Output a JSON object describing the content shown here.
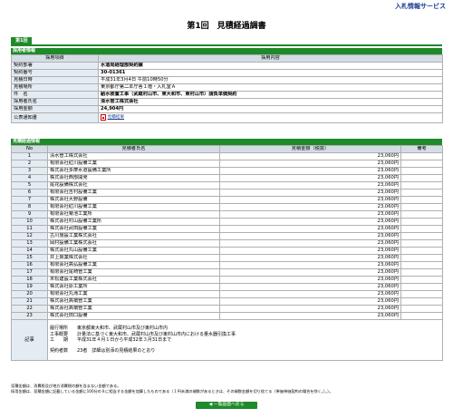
{
  "header": {
    "site_title": "入札情報サービス",
    "doc_title": "第1回　見積経過調書"
  },
  "tab": {
    "label": "第1回"
  },
  "adopted_section": {
    "title": "採用者情報",
    "col_item": "採用項目",
    "col_content": "採用内容",
    "rows": [
      {
        "label": "契約部署",
        "value": "水道局経理部契約課"
      },
      {
        "label": "契約番号",
        "value": "30-01361"
      },
      {
        "label": "見積日時",
        "value": "平成31年3月4日 午前10時50分"
      },
      {
        "label": "見積場所",
        "value": "東京都庁第二本庁舎１階・入札室Ａ"
      },
      {
        "label": "件　名",
        "value": "給水装置工事（武蔵村山市、東大和市、東村山市）請負単価契約"
      },
      {
        "label": "採用者氏名",
        "value": "清水管工株式会社"
      },
      {
        "label": "採用金額",
        "value": "24,904円"
      }
    ],
    "notice": {
      "label": "公表通知書",
      "link": "見積結果"
    }
  },
  "process_section": {
    "title": "見積経過情報",
    "col_no": "No",
    "col_name": "見積者氏名",
    "col_amount": "見積金額（税抜）",
    "col_remarks": "備考",
    "rows": [
      {
        "no": "1",
        "name": "清水管工株式会社",
        "amount": "23,060円",
        "remarks": ""
      },
      {
        "no": "2",
        "name": "有限会社紅川設備工業",
        "amount": "23,060円",
        "remarks": ""
      },
      {
        "no": "3",
        "name": "株式会社多摩水道設備工業所",
        "amount": "23,060円",
        "remarks": ""
      },
      {
        "no": "4",
        "name": "株式会社西部開発",
        "amount": "23,060円",
        "remarks": ""
      },
      {
        "no": "5",
        "name": "尾花設備株式会社",
        "amount": "23,060円",
        "remarks": ""
      },
      {
        "no": "6",
        "name": "有限会社吉村設備工業",
        "amount": "23,060円",
        "remarks": ""
      },
      {
        "no": "7",
        "name": "株式会社大野設備",
        "amount": "23,060円",
        "remarks": ""
      },
      {
        "no": "8",
        "name": "有限会社紅川設備工業",
        "amount": "23,060円",
        "remarks": ""
      },
      {
        "no": "9",
        "name": "有限会社菊池工業所",
        "amount": "23,060円",
        "remarks": ""
      },
      {
        "no": "10",
        "name": "株式会社村山設備工業所",
        "amount": "23,060円",
        "remarks": ""
      },
      {
        "no": "11",
        "name": "株式会社武田設備工業",
        "amount": "23,060円",
        "remarks": ""
      },
      {
        "no": "12",
        "name": "古川施設工業株式会社",
        "amount": "23,060円",
        "remarks": ""
      },
      {
        "no": "13",
        "name": "岡村設備工業株式会社",
        "amount": "23,060円",
        "remarks": ""
      },
      {
        "no": "14",
        "name": "株式会社丸山設備工業",
        "amount": "23,060円",
        "remarks": ""
      },
      {
        "no": "15",
        "name": "井上興業株式会社",
        "amount": "23,060円",
        "remarks": ""
      },
      {
        "no": "16",
        "name": "有限会社高弘設備工業",
        "amount": "23,060円",
        "remarks": ""
      },
      {
        "no": "17",
        "name": "有限会社尾崎管工業",
        "amount": "23,060円",
        "remarks": ""
      },
      {
        "no": "18",
        "name": "末松建設工業株式会社",
        "amount": "23,060円",
        "remarks": ""
      },
      {
        "no": "19",
        "name": "株式会社原工業所",
        "amount": "23,060円",
        "remarks": ""
      },
      {
        "no": "20",
        "name": "有限会社丸滝工業",
        "amount": "23,060円",
        "remarks": ""
      },
      {
        "no": "21",
        "name": "株式会社高橋管工業",
        "amount": "23,060円",
        "remarks": ""
      },
      {
        "no": "22",
        "name": "株式会社高橋管工業",
        "amount": "23,060円",
        "remarks": ""
      },
      {
        "no": "23",
        "name": "株式会社田口設備",
        "amount": "23,060円",
        "remarks": ""
      }
    ],
    "remarks_label": "記事",
    "remarks_text": "履行場所　　東京都東大和市、武蔵村山市及び東村山市内\n工事概要　　計量法に基づく東大和市、武蔵村山市及び東村山市内における量水器引換工事\n工　　期　　平成31年４月１日から平成32年３月31日まで\n\n契約者数　　23者　詳細は別添の見積結果のとおり"
  },
  "notes": {
    "line1": "見積金額は、消費税及び地方消費税の額を含まない金額である。",
    "line2": "採用金額は、見積金額に記載している金額に100分の８に相当する金額を加算したものである（１円未満の端数があるときは、その端数金額を切り捨てる（単価単価契約の場合を除く。）。）。"
  },
  "back_button": {
    "label": "◀ 一覧画面へ戻る"
  }
}
